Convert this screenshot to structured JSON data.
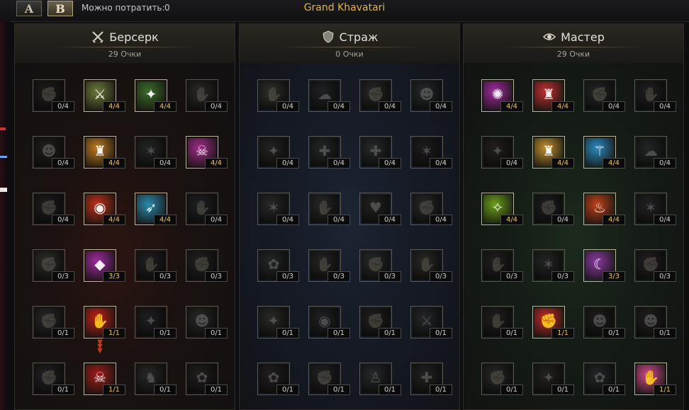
{
  "toolbar": {
    "tab_a": "A",
    "tab_b": "B",
    "spend_label": "Можно потратить:",
    "spend_value": "0",
    "title": "Grand Khavatari"
  },
  "trees": [
    {
      "name": "Берсерк",
      "points": "29 Очки",
      "icon": "crossed-swords-icon",
      "accent": "#3a1510",
      "rows": [
        [
          {
            "level": "0/4",
            "learned": false,
            "color": "#7a3030",
            "glyph": "✊"
          },
          {
            "level": "4/4",
            "learned": true,
            "color": "#6b7a3a",
            "glyph": "⚔"
          },
          {
            "level": "4/4",
            "learned": true,
            "color": "#3a6e2a",
            "glyph": "✦"
          },
          {
            "level": "0/4",
            "learned": false,
            "color": "#6b5a40",
            "glyph": "✋"
          }
        ],
        [
          {
            "level": "0/4",
            "learned": false,
            "color": "#7a3a20",
            "glyph": "☻"
          },
          {
            "level": "4/4",
            "learned": true,
            "color": "#c07a20",
            "glyph": "♜"
          },
          {
            "level": "0/4",
            "learned": false,
            "color": "#3a5a3a",
            "glyph": "✶"
          },
          {
            "level": "4/4",
            "learned": true,
            "color": "#a02a8a",
            "glyph": "☠"
          }
        ],
        [
          {
            "level": "0/4",
            "learned": false,
            "color": "#5a3a3a",
            "glyph": "✊"
          },
          {
            "level": "4/4",
            "learned": true,
            "color": "#c0301a",
            "glyph": "◉"
          },
          {
            "level": "4/4",
            "learned": true,
            "color": "#2a8ab0",
            "glyph": "➶"
          },
          {
            "level": "0/4",
            "learned": false,
            "color": "#3a4a6a",
            "glyph": "✋"
          }
        ],
        [
          {
            "level": "0/3",
            "learned": false,
            "color": "#6a6a30",
            "glyph": "✊"
          },
          {
            "level": "3/3",
            "learned": true,
            "color": "#a02aa0",
            "glyph": "◆"
          },
          {
            "level": "0/3",
            "learned": false,
            "color": "#6a3a4a",
            "glyph": "✋"
          },
          {
            "level": "0/3",
            "learned": false,
            "color": "#4a4a6a",
            "glyph": "✊"
          }
        ],
        [
          {
            "level": "0/1",
            "learned": false,
            "color": "#5a5a5a",
            "glyph": "✊"
          },
          {
            "level": "1/1",
            "learned": true,
            "color": "#c0201a",
            "glyph": "✋"
          },
          {
            "level": "0/1",
            "learned": false,
            "color": "#5a3a5a",
            "glyph": "✦"
          },
          {
            "level": "0/1",
            "learned": false,
            "color": "#5a5a5a",
            "glyph": "☻"
          }
        ],
        [
          {
            "level": "0/1",
            "learned": false,
            "color": "#4a4a6a",
            "glyph": "✊"
          },
          {
            "level": "1/1",
            "learned": true,
            "color": "#a01a1a",
            "glyph": "☠"
          },
          {
            "level": "0/1",
            "learned": false,
            "color": "#5a5a5a",
            "glyph": "♞"
          },
          {
            "level": "0/1",
            "learned": false,
            "color": "#6a3a3a",
            "glyph": "✿"
          }
        ]
      ]
    },
    {
      "name": "Страж",
      "points": "0 Очки",
      "icon": "shield-icon",
      "accent": "#182033",
      "rows": [
        [
          {
            "level": "0/4",
            "learned": false,
            "color": "#6a6a4a",
            "glyph": "✋"
          },
          {
            "level": "0/4",
            "learned": false,
            "color": "#3a4a6a",
            "glyph": "☁"
          },
          {
            "level": "0/4",
            "learned": false,
            "color": "#4a5a4a",
            "glyph": "✊"
          },
          {
            "level": "0/4",
            "learned": false,
            "color": "#2a6a6a",
            "glyph": "☻"
          }
        ],
        [
          {
            "level": "0/4",
            "learned": false,
            "color": "#6a4a2a",
            "glyph": "✦"
          },
          {
            "level": "0/4",
            "learned": false,
            "color": "#3a5a5a",
            "glyph": "✚"
          },
          {
            "level": "0/4",
            "learned": false,
            "color": "#2a6a6a",
            "glyph": "✚"
          },
          {
            "level": "0/4",
            "learned": false,
            "color": "#5a3a3a",
            "glyph": "✶"
          }
        ],
        [
          {
            "level": "0/4",
            "learned": false,
            "color": "#5a5a5a",
            "glyph": "✶"
          },
          {
            "level": "0/4",
            "learned": false,
            "color": "#5a5a3a",
            "glyph": "✋"
          },
          {
            "level": "0/4",
            "learned": false,
            "color": "#5a4a3a",
            "glyph": "♥"
          },
          {
            "level": "0/4",
            "learned": false,
            "color": "#5a5a5a",
            "glyph": "✊"
          }
        ],
        [
          {
            "level": "0/3",
            "learned": false,
            "color": "#3a5a6a",
            "glyph": "✿"
          },
          {
            "level": "0/3",
            "learned": false,
            "color": "#6a4a3a",
            "glyph": "✋"
          },
          {
            "level": "0/3",
            "learned": false,
            "color": "#3a6a4a",
            "glyph": "✊"
          },
          {
            "level": "0/3",
            "learned": false,
            "color": "#6a5a3a",
            "glyph": "✋"
          }
        ],
        [
          {
            "level": "0/1",
            "learned": false,
            "color": "#4a6a2a",
            "glyph": "✦"
          },
          {
            "level": "0/1",
            "learned": false,
            "color": "#3a4a6a",
            "glyph": "◉"
          },
          {
            "level": "0/1",
            "learned": false,
            "color": "#6a3a4a",
            "glyph": "✊"
          },
          {
            "level": "0/1",
            "learned": false,
            "color": "#3a5a6a",
            "glyph": "⚔"
          }
        ],
        [
          {
            "level": "0/1",
            "learned": false,
            "color": "#6a3a3a",
            "glyph": "✿"
          },
          {
            "level": "0/1",
            "learned": false,
            "color": "#4a4a6a",
            "glyph": "✊"
          },
          {
            "level": "0/1",
            "learned": false,
            "color": "#2a6a6a",
            "glyph": "♙"
          },
          {
            "level": "0/1",
            "learned": false,
            "color": "#5a4a3a",
            "glyph": "✚"
          }
        ]
      ]
    },
    {
      "name": "Мастер",
      "points": "29 Очки",
      "icon": "eye-icon",
      "accent": "#162316",
      "rows": [
        [
          {
            "level": "4/4",
            "learned": true,
            "color": "#a02aa0",
            "glyph": "✺"
          },
          {
            "level": "4/4",
            "learned": true,
            "color": "#c03030",
            "glyph": "♜"
          },
          {
            "level": "0/4",
            "learned": false,
            "color": "#3a5a4a",
            "glyph": "✊"
          },
          {
            "level": "0/4",
            "learned": false,
            "color": "#6a3a5a",
            "glyph": "✋"
          }
        ],
        [
          {
            "level": "0/4",
            "learned": false,
            "color": "#7a3a2a",
            "glyph": "✦"
          },
          {
            "level": "4/4",
            "learned": true,
            "color": "#c09030",
            "glyph": "♜"
          },
          {
            "level": "4/4",
            "learned": true,
            "color": "#2a8ac0",
            "glyph": "⚚"
          },
          {
            "level": "0/4",
            "learned": false,
            "color": "#3a5a5a",
            "glyph": "☁"
          }
        ],
        [
          {
            "level": "4/4",
            "learned": true,
            "color": "#6aa01a",
            "glyph": "✧"
          },
          {
            "level": "0/4",
            "learned": false,
            "color": "#5a3a4a",
            "glyph": "✊"
          },
          {
            "level": "4/4",
            "learned": true,
            "color": "#c0401a",
            "glyph": "♨"
          },
          {
            "level": "0/4",
            "learned": false,
            "color": "#4a4a6a",
            "glyph": "✶"
          }
        ],
        [
          {
            "level": "0/3",
            "learned": false,
            "color": "#6a3a5a",
            "glyph": "✋"
          },
          {
            "level": "0/3",
            "learned": false,
            "color": "#3a5a3a",
            "glyph": "✶"
          },
          {
            "level": "3/3",
            "learned": true,
            "color": "#8a3aa0",
            "glyph": "☾"
          },
          {
            "level": "0/3",
            "learned": false,
            "color": "#6a3a4a",
            "glyph": "✊"
          }
        ],
        [
          {
            "level": "0/1",
            "learned": false,
            "color": "#6a3a3a",
            "glyph": "✋"
          },
          {
            "level": "1/1",
            "learned": true,
            "color": "#c02a2a",
            "glyph": "✊"
          },
          {
            "level": "0/1",
            "learned": false,
            "color": "#5a3a3a",
            "glyph": "☻"
          },
          {
            "level": "0/1",
            "learned": false,
            "color": "#6a3a3a",
            "glyph": "☻"
          }
        ],
        [
          {
            "level": "0/1",
            "learned": false,
            "color": "#4a5a6a",
            "glyph": "✊"
          },
          {
            "level": "0/1",
            "learned": false,
            "color": "#6a4a2a",
            "glyph": "✦"
          },
          {
            "level": "0/1",
            "learned": false,
            "color": "#3a5a6a",
            "glyph": "✿"
          },
          {
            "level": "1/1",
            "learned": true,
            "color": "#d04a8a",
            "glyph": "✋"
          }
        ]
      ]
    }
  ]
}
